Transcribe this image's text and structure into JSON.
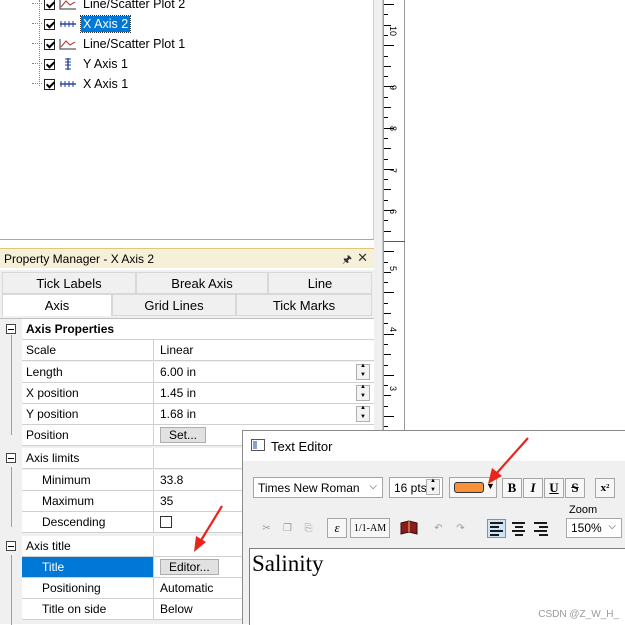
{
  "tree": {
    "items": [
      {
        "label": "Line/Scatter Plot 2",
        "icon": "line-scatter-plot-icon",
        "selected": false
      },
      {
        "label": "X Axis 2",
        "icon": "x-axis-icon",
        "selected": true
      },
      {
        "label": "Line/Scatter Plot 1",
        "icon": "line-scatter-plot-icon",
        "selected": false
      },
      {
        "label": "Y Axis 1",
        "icon": "y-axis-icon",
        "selected": false
      },
      {
        "label": "X Axis 1",
        "icon": "x-axis-icon",
        "selected": false
      }
    ]
  },
  "ruler": {
    "labels": [
      "10",
      "9",
      "8",
      "7",
      "6",
      "5",
      "4",
      "3"
    ]
  },
  "property_manager": {
    "title": "Property Manager - X Axis 2",
    "tabs_row1": [
      "Tick Labels",
      "Break Axis",
      "Line"
    ],
    "tabs_row2": [
      "Axis",
      "Grid Lines",
      "Tick Marks"
    ],
    "active_tab": "Axis",
    "groups": {
      "axis_properties": "Axis Properties",
      "axis_limits": "Axis limits",
      "axis_title": "Axis title"
    },
    "rows": {
      "scale": {
        "label": "Scale",
        "value": "Linear"
      },
      "length": {
        "label": "Length",
        "value": "6.00 in"
      },
      "x_position": {
        "label": "X position",
        "value": "1.45 in"
      },
      "y_position": {
        "label": "Y position",
        "value": "1.68 in"
      },
      "position": {
        "label": "Position",
        "button": "Set..."
      },
      "minimum": {
        "label": "Minimum",
        "value": "33.8"
      },
      "maximum": {
        "label": "Maximum",
        "value": "35"
      },
      "descending": {
        "label": "Descending",
        "checked": false
      },
      "title": {
        "label": "Title",
        "button": "Editor..."
      },
      "positioning": {
        "label": "Positioning",
        "value": "Automatic"
      },
      "title_on_side": {
        "label": "Title on side",
        "value": "Below"
      }
    }
  },
  "text_editor": {
    "title": "Text Editor",
    "font": "Times New Roman",
    "size": "16 pts",
    "color": "#f7923a",
    "bold": "B",
    "italic": "I",
    "underline": "U",
    "strike": "S",
    "superscript": "x²",
    "symbol_btn": "ε",
    "fraction_btn": "1/1-AM",
    "zoom_label": "Zoom",
    "zoom": "150%",
    "content": "Salinity"
  },
  "watermark": "CSDN @Z_W_H_"
}
